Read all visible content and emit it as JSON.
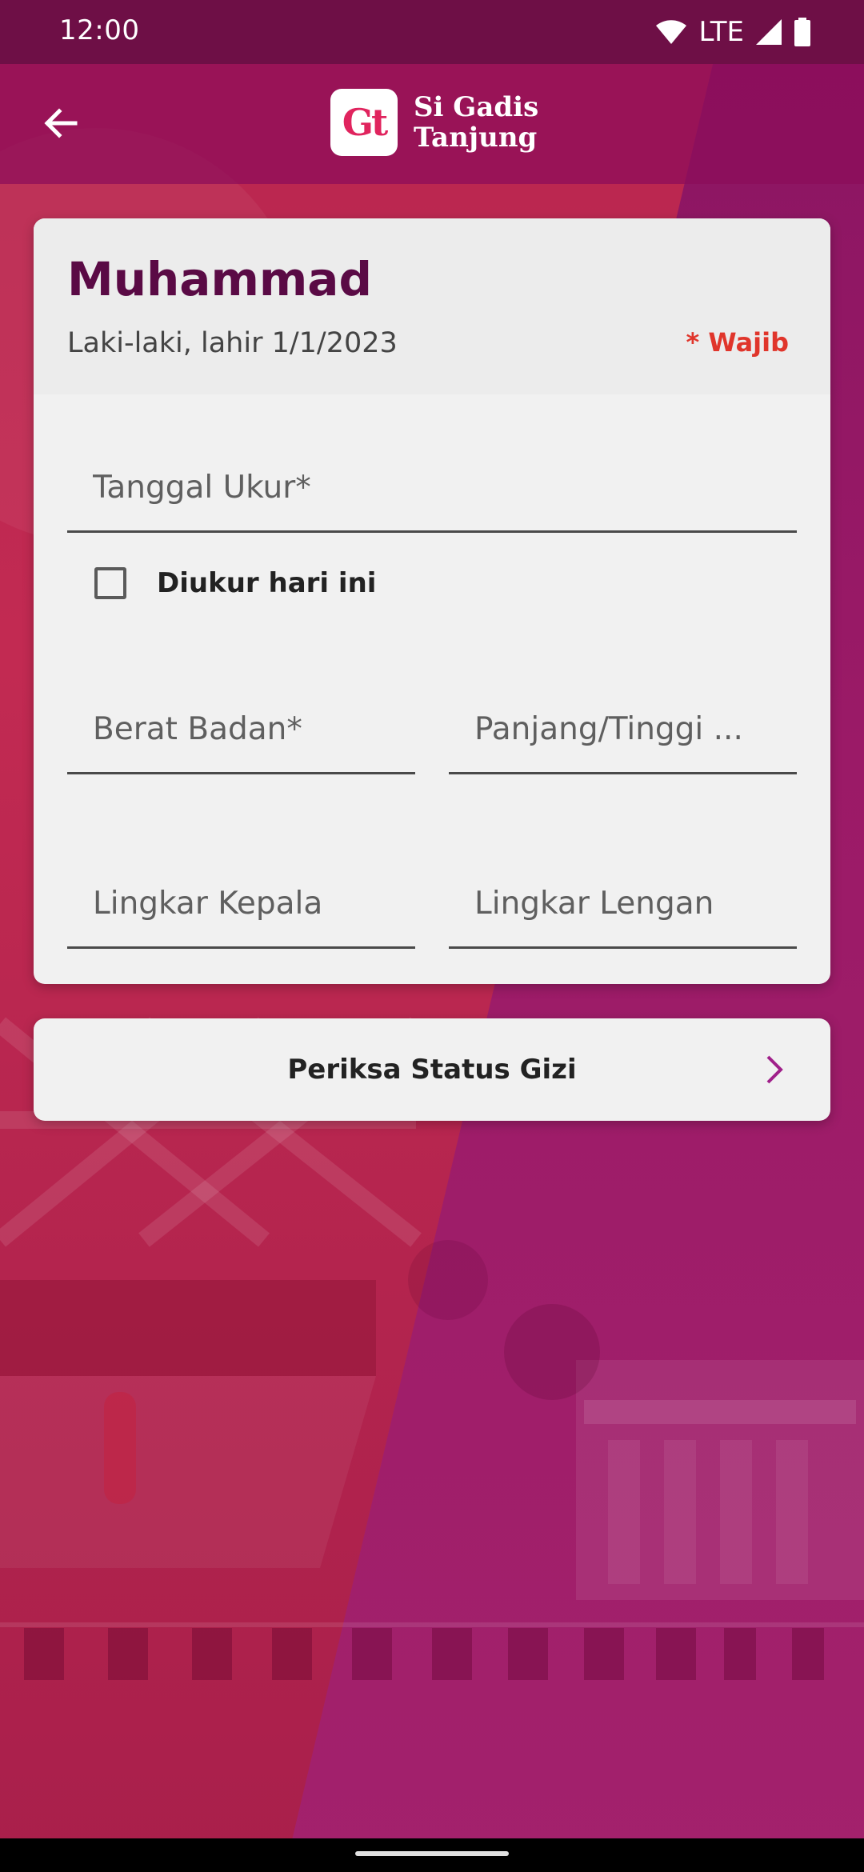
{
  "status_bar": {
    "time": "12:00",
    "network": "LTE",
    "icons": [
      "wifi-icon",
      "signal-icon",
      "battery-icon"
    ]
  },
  "app_bar": {
    "back_icon": "arrow-left-icon",
    "logo_mark": "Gt",
    "brand_line1": "Si Gadis",
    "brand_line2": "Tanjung"
  },
  "child": {
    "name": "Muhammad",
    "info": "Laki-laki, lahir 1/1/2023",
    "required_note": "* Wajib"
  },
  "form": {
    "measure_date": {
      "placeholder": "Tanggal Ukur*",
      "value": ""
    },
    "today_checkbox": {
      "label": "Diukur hari ini",
      "checked": false
    },
    "weight": {
      "placeholder": "Berat Badan*",
      "value": ""
    },
    "height": {
      "placeholder": "Panjang/Tinggi ...",
      "value": ""
    },
    "head_circumference": {
      "placeholder": "Lingkar Kepala",
      "value": ""
    },
    "arm_circumference": {
      "placeholder": "Lingkar Lengan",
      "value": ""
    }
  },
  "action": {
    "label": "Periksa Status Gizi",
    "icon": "chevron-right-icon"
  },
  "colors": {
    "status_bar": "#6e0f46",
    "app_bar": "#8c0c5a",
    "name_text": "#5a0a45",
    "required_text": "#e0352b",
    "chevron": "#a0208a",
    "card": "#f1f1f1"
  }
}
